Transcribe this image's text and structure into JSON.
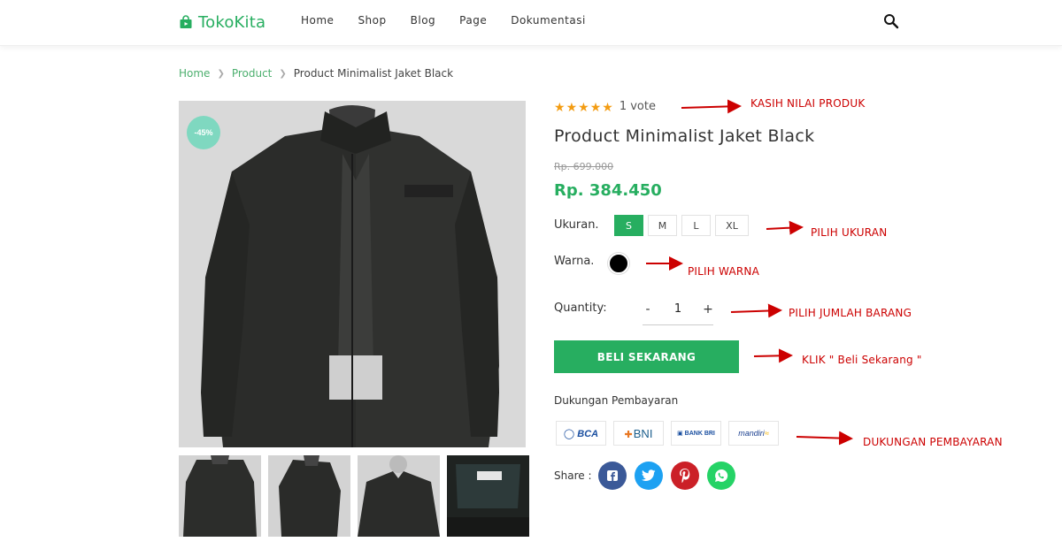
{
  "header": {
    "logo_text": "TokoKita",
    "nav": [
      "Home",
      "Shop",
      "Blog",
      "Page",
      "Dokumentasi"
    ]
  },
  "breadcrumb": [
    "Home",
    "Product",
    "Product Minimalist Jaket Black"
  ],
  "product": {
    "discount_badge": "-45%",
    "rating_stars": 5,
    "vote_text": "1 vote",
    "title": "Product Minimalist Jaket Black",
    "old_price": "Rp. 699.000",
    "new_price": "Rp. 384.450",
    "size_label": "Ukuran.",
    "sizes": [
      "S",
      "M",
      "L",
      "XL"
    ],
    "selected_size": "S",
    "color_label": "Warna.",
    "selected_color": "#000000",
    "quantity_label": "Quantity:",
    "quantity_minus": "-",
    "quantity_value": "1",
    "quantity_plus": "+",
    "buy_button": "BELI SEKARANG",
    "payment_label": "Dukungan Pembayaran",
    "payments": [
      "BCA",
      "BNI",
      "BANK BRI",
      "mandiri"
    ],
    "share_label": "Share :"
  },
  "annotations": {
    "rating": "KASIH NILAI PRODUK",
    "size": "PILIH UKURAN",
    "color": "PILIH WARNA",
    "quantity": "PILIH JUMLAH BARANG",
    "buy": "KLIK \" Beli Sekarang \"",
    "payment": "DUKUNGAN PEMBAYARAN"
  },
  "colors": {
    "accent": "#27ae60",
    "annotation": "#cc0000",
    "star": "#f39c12"
  }
}
